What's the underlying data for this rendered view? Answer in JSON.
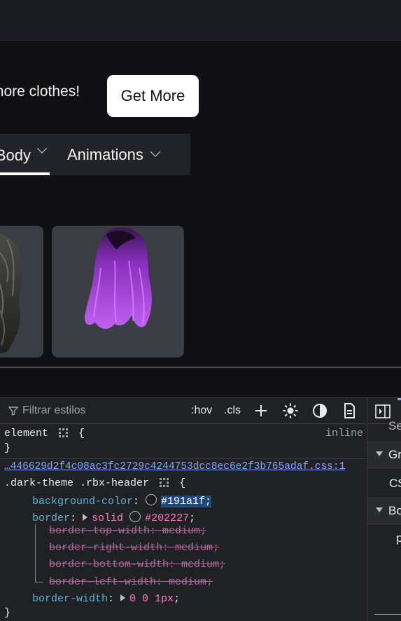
{
  "promo": {
    "text": "more clothes!",
    "button": "Get More"
  },
  "tabs": [
    {
      "label": "Body"
    },
    {
      "label": "Animations"
    }
  ],
  "cards": [
    {
      "name": "dark-hair"
    },
    {
      "name": "purple-hair"
    }
  ],
  "devtools": {
    "filter_placeholder": "Filtrar estilos",
    "hov": ":hov",
    "cls": ".cls",
    "element_selector": "element",
    "element_open": "{",
    "element_close": "}",
    "inline_label": "inline",
    "source_link": "…446629d2f4c08ac3fc2729c4244753dcc8ec6e2f3b765adaf.css:1",
    "rule_selector": ".dark-theme .rbx-header",
    "rule_open": "{",
    "rule_close": "}",
    "props": {
      "bg_name": "background-color",
      "bg_value": "#191a1f;",
      "border_name": "border",
      "border_style": "solid",
      "border_color": "#202227",
      "border_semicolon": ";",
      "sub": [
        {
          "name": "border-top-width",
          "value": "medium"
        },
        {
          "name": "border-right-width",
          "value": "medium"
        },
        {
          "name": "border-bottom-width",
          "value": "medium"
        },
        {
          "name": "border-left-width",
          "value": "medium"
        }
      ],
      "bw_name": "border-width",
      "bw_value": "0 0 1px"
    },
    "colors": {
      "swatch1": "#191a1f",
      "swatch2": "#202227"
    },
    "right_panel": {
      "row1": "Se",
      "row2": "Gr",
      "row3": "CS",
      "row4": "Bo",
      "row5": "p"
    }
  }
}
